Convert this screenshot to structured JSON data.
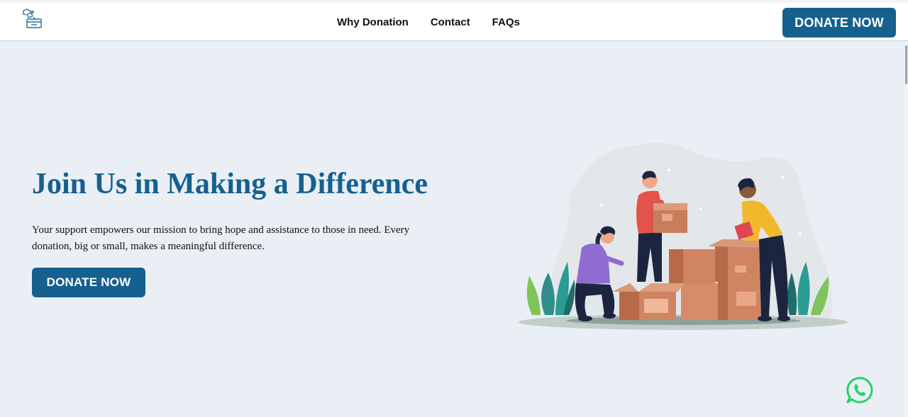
{
  "nav": {
    "logo_icon": "donation-box-icon",
    "links": [
      {
        "label": "Why Donation"
      },
      {
        "label": "Contact"
      },
      {
        "label": "FAQs"
      }
    ],
    "donate_label": "DONATE NOW"
  },
  "hero": {
    "title": "Join Us in Making a Difference",
    "text": "Your support empowers our mission to bring hope and assistance to those in need. Every donation, big or small, makes a meaningful difference.",
    "donate_label": "DONATE NOW",
    "illustration_icon": "volunteers-packing-boxes-illustration"
  },
  "floating": {
    "whatsapp_icon": "whatsapp-icon"
  },
  "colors": {
    "brand": "#16608f",
    "background": "#e9eff5",
    "whatsapp": "#25d366"
  }
}
